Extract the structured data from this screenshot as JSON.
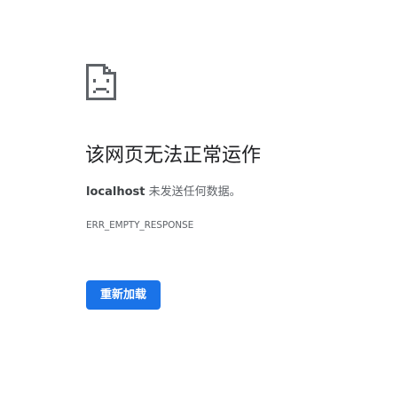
{
  "error_page": {
    "heading": "该网页无法正常运作",
    "host": "localhost",
    "message_suffix": " 未发送任何数据。",
    "error_code": "ERR_EMPTY_RESPONSE",
    "reload_label": "重新加载",
    "icon": "sad-page-icon",
    "accent_color": "#1a73e8"
  }
}
